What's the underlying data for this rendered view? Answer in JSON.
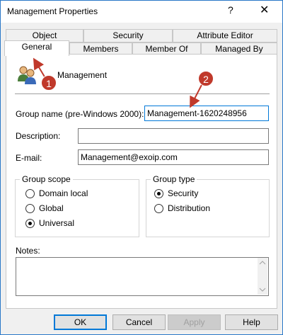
{
  "window": {
    "title": "Management Properties",
    "help_glyph": "?",
    "close_glyph": "✕"
  },
  "tabs": {
    "row_back": [
      {
        "label": "Object"
      },
      {
        "label": "Security"
      },
      {
        "label": "Attribute Editor"
      }
    ],
    "row_front": [
      {
        "label": "General",
        "active": true
      },
      {
        "label": "Members"
      },
      {
        "label": "Member Of"
      },
      {
        "label": "Managed By"
      }
    ]
  },
  "general": {
    "group_name": "Management",
    "group_name_pre2000_label": "Group name (pre-Windows 2000):",
    "group_name_pre2000_value": "Management-1620248956",
    "description_label": "Description:",
    "description_value": "",
    "email_label": "E-mail:",
    "email_value": "Management@exoip.com",
    "group_scope": {
      "label": "Group scope",
      "options": [
        "Domain local",
        "Global",
        "Universal"
      ],
      "selected": "Universal"
    },
    "group_type": {
      "label": "Group type",
      "options": [
        "Security",
        "Distribution"
      ],
      "selected": "Security"
    },
    "notes_label": "Notes:",
    "notes_value": ""
  },
  "annotations": {
    "badge_1": "1",
    "badge_2": "2",
    "color": "#c0392b"
  },
  "buttons": {
    "ok": "OK",
    "cancel": "Cancel",
    "apply": "Apply",
    "help": "Help"
  }
}
